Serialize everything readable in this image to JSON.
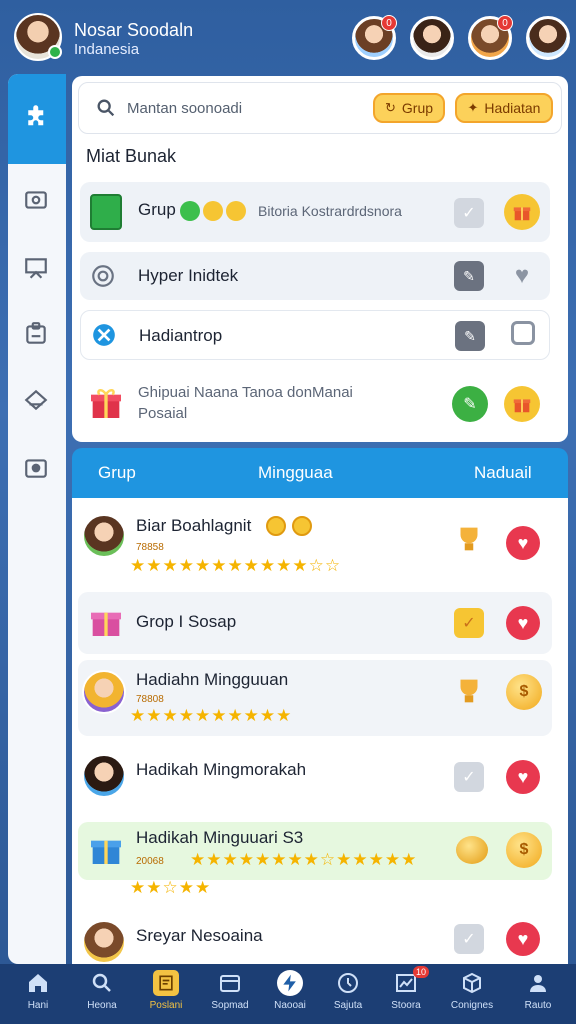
{
  "user": {
    "name": "Nosar Soodaln",
    "region": "Indanesia"
  },
  "friends": [
    {
      "badge": "0"
    },
    {
      "badge": ""
    },
    {
      "badge": "0"
    },
    {
      "badge": ""
    }
  ],
  "search": {
    "placeholder": "Mantan soonoadi",
    "grup_button": "Grup",
    "hadiah_button": "Hadiatan"
  },
  "panel": {
    "section_title": "Miat Bunak",
    "rows": [
      {
        "title": "Grup",
        "meta": "Bitoria Kostrardrdsnora",
        "icon": "money-icon",
        "action": "gift-icon"
      },
      {
        "title": "Hyper Inidtek",
        "icon": "target-icon",
        "action": "heart-icon"
      },
      {
        "title": "Hadiantrop",
        "icon": "tool-icon",
        "action": "checkbox"
      },
      {
        "title": "Ghipuai Naana Tanoa donManai",
        "subtitle": "Posaial",
        "icon": "gift-icon",
        "action": "gift-icon"
      }
    ]
  },
  "tabs": {
    "grup": "Grup",
    "mingguan": "Mingguaa",
    "hadiah": "Naduail"
  },
  "list": [
    {
      "name": "Biar Boahlagnit",
      "points": "78858",
      "stars": "★★★★★★★★★★★☆☆",
      "bg": "white"
    },
    {
      "name": "Grop I Sosap",
      "points": "",
      "stars": "",
      "bg": "gray"
    },
    {
      "name": "Hadiahn Mingguuan",
      "points": "78808",
      "stars": "★★★★★★★★★★",
      "bg": "gray"
    },
    {
      "name": "Hadikah Mingmorakah",
      "points": "",
      "stars": "",
      "bg": "white"
    },
    {
      "name": "Hadikah Minguuari S3",
      "points": "20068",
      "stars": "★★★★★★★★☆★★★★★",
      "stars2": "★★☆★★",
      "bg": "green"
    },
    {
      "name": "Sreyar Nesoaina",
      "points": "",
      "stars": "",
      "bg": "white"
    }
  ],
  "bottom_nav": [
    {
      "label": "Hani",
      "icon": "home-icon"
    },
    {
      "label": "Heona",
      "icon": "search-icon"
    },
    {
      "label": "Poslani",
      "icon": "note-icon",
      "active": true
    },
    {
      "label": "Sopmad",
      "icon": "calendar-icon"
    },
    {
      "label": "Naooai",
      "icon": "lightning-icon"
    },
    {
      "label": "Sajuta",
      "icon": "clock-icon"
    },
    {
      "label": "Stoora",
      "icon": "chart-icon",
      "badge": "10"
    },
    {
      "label": "Conignes",
      "icon": "cube-icon"
    },
    {
      "label": "Rauto",
      "icon": "user-icon"
    }
  ]
}
